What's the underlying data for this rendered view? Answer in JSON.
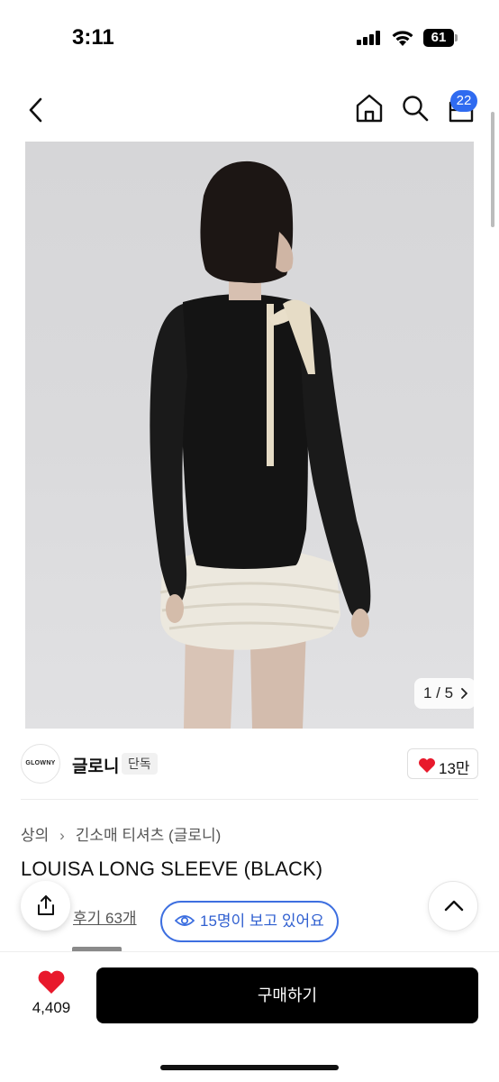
{
  "status": {
    "time": "3:11",
    "battery": "61"
  },
  "nav": {
    "cart_count": "22"
  },
  "gallery": {
    "counter": "1 / 5"
  },
  "brand": {
    "logo_text": "GLOWNY",
    "name": "글로니",
    "tag": "단독",
    "likes": "13만"
  },
  "product": {
    "breadcrumb": [
      "상의",
      "긴소매 티셔츠 (글로니)"
    ],
    "title": "LOUISA LONG SLEEVE (BLACK)",
    "review_link": "후기 63개",
    "viewers": "15명이 보고 있어요"
  },
  "bottom": {
    "wish_count": "4,409",
    "buy_label": "구매하기"
  },
  "colors": {
    "accent_blue": "#2f6bf0",
    "heart_red": "#e8192c",
    "buy_button": "#000000"
  },
  "icons": [
    "back-icon",
    "home-icon",
    "search-icon",
    "shopping-bag-icon",
    "heart-icon",
    "eye-icon",
    "share-icon",
    "chevron-up-icon",
    "chevron-right-icon"
  ]
}
